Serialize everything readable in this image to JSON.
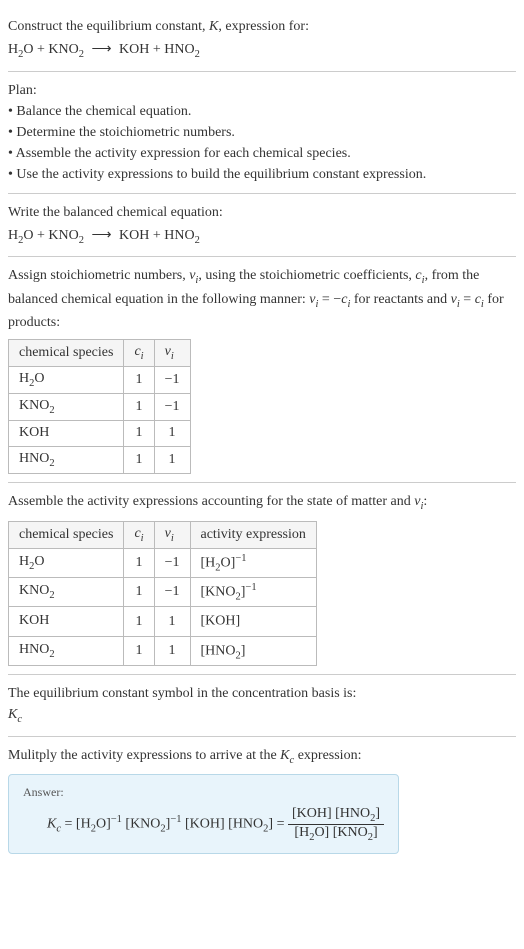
{
  "intro": {
    "line1": "Construct the equilibrium constant, ",
    "K": "K",
    "line1b": ", expression for:",
    "equation_lhs1": "H",
    "equation_sub1": "2",
    "equation_lhs2": "O + KNO",
    "equation_sub2": "2",
    "arrow": "⟶",
    "equation_rhs1": "KOH + HNO",
    "equation_sub3": "2"
  },
  "plan": {
    "title": "Plan:",
    "b1": "• Balance the chemical equation.",
    "b2": "• Determine the stoichiometric numbers.",
    "b3": "• Assemble the activity expression for each chemical species.",
    "b4": "• Use the activity expressions to build the equilibrium constant expression."
  },
  "balanced": {
    "title": "Write the balanced chemical equation:",
    "lhs1": "H",
    "sub1": "2",
    "lhs2": "O + KNO",
    "sub2": "2",
    "arrow": "⟶",
    "rhs1": "KOH + HNO",
    "sub3": "2"
  },
  "stoich": {
    "text1": "Assign stoichiometric numbers, ",
    "nu_i": "ν",
    "sub_i": "i",
    "text2": ", using the stoichiometric coefficients, ",
    "c_i": "c",
    "text3": ", from the balanced chemical equation in the following manner: ",
    "eq1a": "ν",
    "eq1b": " = −",
    "eq1c": "c",
    "text4": " for reactants and ",
    "eq2a": "ν",
    "eq2b": " = ",
    "eq2c": "c",
    "text5": " for products:",
    "headers": {
      "h1": "chemical species",
      "h2": "c",
      "h2sub": "i",
      "h3": "ν",
      "h3sub": "i"
    },
    "rows": [
      {
        "species_a": "H",
        "species_sub": "2",
        "species_b": "O",
        "c": "1",
        "nu": "−1"
      },
      {
        "species_a": "KNO",
        "species_sub": "2",
        "species_b": "",
        "c": "1",
        "nu": "−1"
      },
      {
        "species_a": "KOH",
        "species_sub": "",
        "species_b": "",
        "c": "1",
        "nu": "1"
      },
      {
        "species_a": "HNO",
        "species_sub": "2",
        "species_b": "",
        "c": "1",
        "nu": "1"
      }
    ]
  },
  "activity": {
    "title1": "Assemble the activity expressions accounting for the state of matter and ",
    "nu": "ν",
    "sub_i": "i",
    "title2": ":",
    "headers": {
      "h1": "chemical species",
      "h2": "c",
      "h2sub": "i",
      "h3": "ν",
      "h3sub": "i",
      "h4": "activity expression"
    },
    "rows": [
      {
        "sa": "H",
        "ssub": "2",
        "sb": "O",
        "c": "1",
        "nu": "−1",
        "ea": "[H",
        "esub": "2",
        "eb": "O]",
        "esup": "−1"
      },
      {
        "sa": "KNO",
        "ssub": "2",
        "sb": "",
        "c": "1",
        "nu": "−1",
        "ea": "[KNO",
        "esub": "2",
        "eb": "]",
        "esup": "−1"
      },
      {
        "sa": "KOH",
        "ssub": "",
        "sb": "",
        "c": "1",
        "nu": "1",
        "ea": "[KOH]",
        "esub": "",
        "eb": "",
        "esup": ""
      },
      {
        "sa": "HNO",
        "ssub": "2",
        "sb": "",
        "c": "1",
        "nu": "1",
        "ea": "[HNO",
        "esub": "2",
        "eb": "]",
        "esup": ""
      }
    ]
  },
  "symbol": {
    "text": "The equilibrium constant symbol in the concentration basis is:",
    "K": "K",
    "sub": "c"
  },
  "mult": {
    "text1": "Mulitply the activity expressions to arrive at the ",
    "K": "K",
    "sub": "c",
    "text2": " expression:"
  },
  "answer": {
    "label": "Answer:",
    "K": "K",
    "Ksub": "c",
    "eq": " = ",
    "t1a": "[H",
    "t1sub": "2",
    "t1b": "O]",
    "t1sup": "−1",
    "sp1": " ",
    "t2a": "[KNO",
    "t2sub": "2",
    "t2b": "]",
    "t2sup": "−1",
    "sp2": " ",
    "t3": "[KOH]",
    "sp3": " ",
    "t4a": "[HNO",
    "t4sub": "2",
    "t4b": "]",
    "eq2": " = ",
    "num1": "[KOH] [HNO",
    "numsub": "2",
    "num2": "]",
    "den1a": "[H",
    "den1sub": "2",
    "den1b": "O]",
    "den2a": " [KNO",
    "den2sub": "2",
    "den2b": "]"
  }
}
